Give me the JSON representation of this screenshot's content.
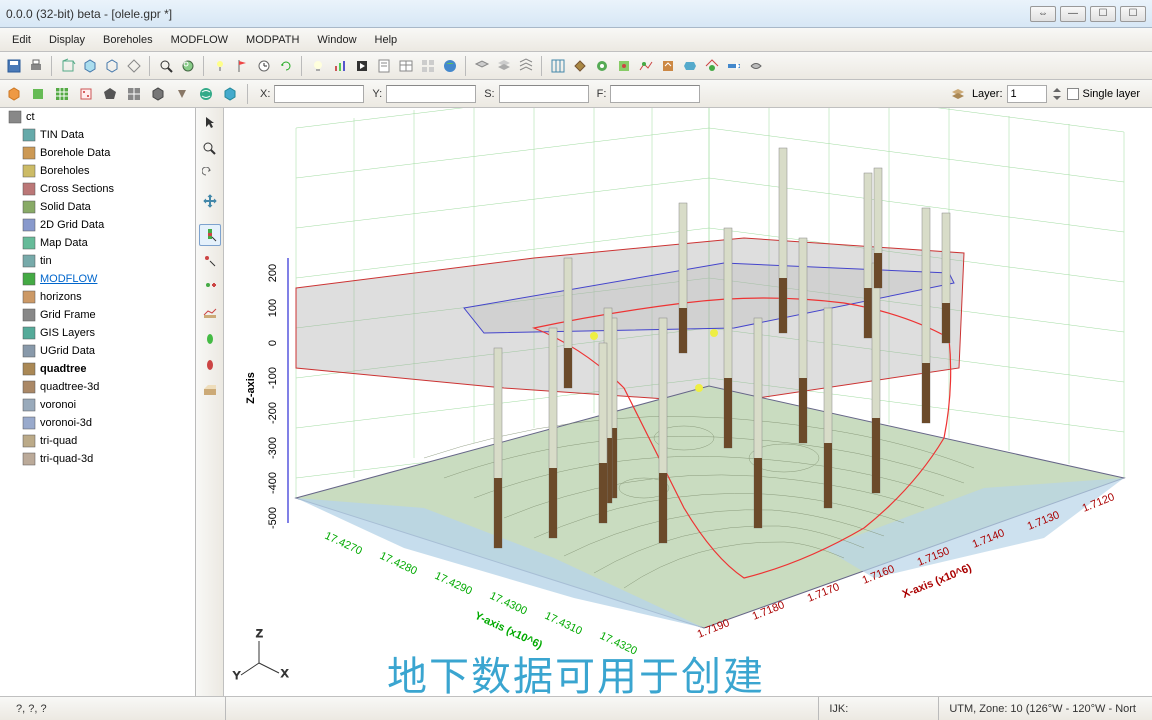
{
  "title": "0.0.0 (32-bit) beta - [olele.gpr *]",
  "menus": [
    "Edit",
    "Display",
    "Boreholes",
    "MODFLOW",
    "MODPATH",
    "Window",
    "Help"
  ],
  "coord_bar": {
    "x_label": "X:",
    "y_label": "Y:",
    "s_label": "S:",
    "f_label": "F:",
    "layer_label": "Layer:",
    "layer_value": "1",
    "single_layer_label": "Single layer"
  },
  "tree": [
    {
      "label": "ct",
      "icon": "root"
    },
    {
      "label": "TIN Data",
      "icon": "tin",
      "indent": true
    },
    {
      "label": "Borehole Data",
      "icon": "borehole",
      "indent": true
    },
    {
      "label": "Boreholes",
      "icon": "boreholes",
      "indent": true
    },
    {
      "label": "Cross Sections",
      "icon": "cross",
      "indent": true
    },
    {
      "label": "Solid Data",
      "icon": "solid",
      "indent": true
    },
    {
      "label": "2D Grid Data",
      "icon": "grid2d",
      "indent": true
    },
    {
      "label": "Map Data",
      "icon": "map",
      "indent": true
    },
    {
      "label": "tin",
      "icon": "tin2",
      "indent": true
    },
    {
      "label": "MODFLOW",
      "icon": "modflow",
      "indent": true,
      "link": true
    },
    {
      "label": "horizons",
      "icon": "horizons",
      "indent": true
    },
    {
      "label": "Grid Frame",
      "icon": "gridframe",
      "indent": true
    },
    {
      "label": "GIS Layers",
      "icon": "gis",
      "indent": true
    },
    {
      "label": "UGrid Data",
      "icon": "ugrid",
      "indent": true
    },
    {
      "label": "quadtree",
      "icon": "quadtree",
      "indent": true,
      "bold": true
    },
    {
      "label": "quadtree-3d",
      "icon": "quad3d",
      "indent": true
    },
    {
      "label": "voronoi",
      "icon": "voronoi",
      "indent": true
    },
    {
      "label": "voronoi-3d",
      "icon": "voronoi3d",
      "indent": true
    },
    {
      "label": "tri-quad",
      "icon": "triquad",
      "indent": true
    },
    {
      "label": "tri-quad-3d",
      "icon": "triquad3d",
      "indent": true
    }
  ],
  "axes": {
    "z_label": "Z-axis",
    "z_ticks": [
      "200",
      "100",
      "0",
      "-100",
      "-200",
      "-300",
      "-400",
      "-500"
    ],
    "y_label": "Y-axis (x10^6)",
    "y_ticks": [
      "17.4270",
      "17.4280",
      "17.4290",
      "17.4300",
      "17.4310",
      "17.4320"
    ],
    "x_label": "X-axis (x10^6)",
    "x_ticks": [
      "1.7190",
      "1.7180",
      "1.7170",
      "1.7160",
      "1.7150",
      "1.7140",
      "1.7130",
      "1.7120"
    ]
  },
  "status": {
    "left": "?, ?, ?",
    "mid": "",
    "ijk": "IJK:",
    "right": "UTM,  Zone: 10 (126°W - 120°W - Nort"
  },
  "subtitle": "地下数据可用于创建"
}
